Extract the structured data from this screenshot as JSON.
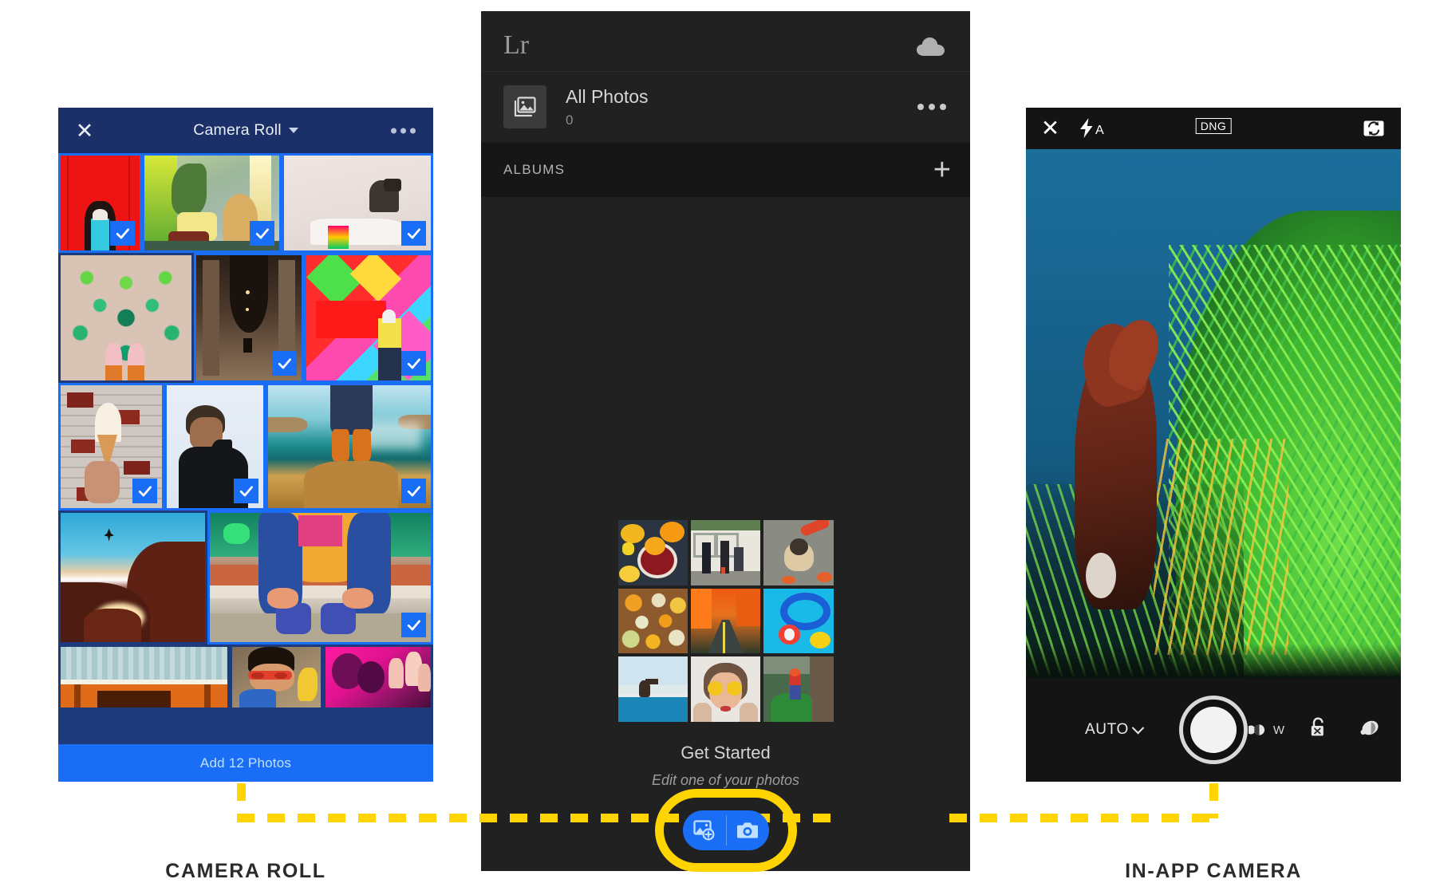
{
  "camera_roll": {
    "close_icon": "close-icon",
    "title": "Camera Roll",
    "more_icon": "overflow-menu-icon",
    "add_button_label": "Add 12 Photos",
    "photos": [
      {
        "id": "p1",
        "alt": "woman in red doorway",
        "selected": true
      },
      {
        "id": "p2",
        "alt": "living room with plants",
        "selected": true
      },
      {
        "id": "p3",
        "alt": "couple in bed",
        "selected": true
      },
      {
        "id": "p4",
        "alt": "pink boots on green mural",
        "selected": false
      },
      {
        "id": "p5",
        "alt": "arched corridor",
        "selected": true
      },
      {
        "id": "p6",
        "alt": "colorful wall mural",
        "selected": true
      },
      {
        "id": "p7",
        "alt": "ice cream at brick wall",
        "selected": true
      },
      {
        "id": "p8",
        "alt": "man in black hoodie",
        "selected": true
      },
      {
        "id": "p9",
        "alt": "boots on coastal rock",
        "selected": true
      },
      {
        "id": "p10",
        "alt": "jumper over red rocks",
        "selected": false
      },
      {
        "id": "p11",
        "alt": "blond woman tying boots",
        "selected": true
      },
      {
        "id": "p12",
        "alt": "orange cabin roof",
        "selected": false
      },
      {
        "id": "p13",
        "alt": "man with sunglasses and banana",
        "selected": false
      },
      {
        "id": "p14",
        "alt": "pink flowers macro",
        "selected": false
      }
    ]
  },
  "lightroom": {
    "logo": "Lr",
    "cloud_icon": "cloud-icon",
    "all_photos": {
      "icon": "photos-library-icon",
      "title": "All Photos",
      "count": "0",
      "more_icon": "overflow-menu-icon"
    },
    "albums": {
      "label": "ALBUMS",
      "add_icon": "plus-icon"
    },
    "get_started": {
      "title": "Get Started",
      "subtitle": "Edit one of your photos",
      "thumbs": [
        {
          "id": "g1",
          "alt": "citrus drink flatlay"
        },
        {
          "id": "g2",
          "alt": "three people by wall"
        },
        {
          "id": "g3",
          "alt": "pug on pavement"
        },
        {
          "id": "g4",
          "alt": "pumpkins"
        },
        {
          "id": "g5",
          "alt": "autumn forest road"
        },
        {
          "id": "g6",
          "alt": "pool floats"
        },
        {
          "id": "g7",
          "alt": "pelican on rail"
        },
        {
          "id": "g8",
          "alt": "woman with sunflowers"
        },
        {
          "id": "g9",
          "alt": "hiker on cliff"
        }
      ]
    },
    "actions": {
      "add_photo_icon": "add-photo-icon",
      "camera_icon": "camera-icon",
      "highlight_color": "#ffd400",
      "pill_color": "#1a6ef5"
    }
  },
  "camera": {
    "close_icon": "close-icon",
    "flash_icon": "flash-auto-icon",
    "flash_mode": "A",
    "format_badge": "DNG",
    "flip_icon": "switch-camera-icon",
    "preview_alt": "brown dog at blue water edge with green grass",
    "mode_label": "AUTO",
    "mode_caret_icon": "chevron-down-icon",
    "shutter_icon": "shutter-button",
    "white_balance_icon": "white-balance-icon",
    "white_balance_label": "W",
    "lock_icon": "exposure-lock-icon",
    "preset_icon": "preset-icon"
  },
  "captions": {
    "left": "CAMERA ROLL",
    "right": "IN-APP CAMERA"
  },
  "colors": {
    "accent_blue": "#1a6ef5",
    "highlight_yellow": "#ffd400",
    "panel_dark": "#212121",
    "camera_roll_bg": "#1d3a7a"
  }
}
